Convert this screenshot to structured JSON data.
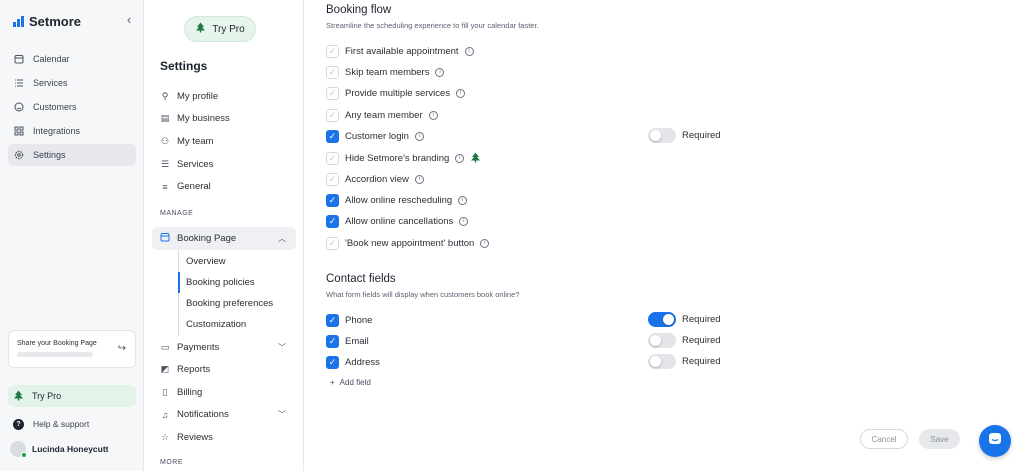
{
  "app": {
    "name": "Setmore"
  },
  "rail": {
    "items": [
      {
        "label": "Calendar",
        "icon": "calendar-icon"
      },
      {
        "label": "Services",
        "icon": "list-icon"
      },
      {
        "label": "Customers",
        "icon": "smiley-icon"
      },
      {
        "label": "Integrations",
        "icon": "grid-icon"
      },
      {
        "label": "Settings",
        "icon": "gear-icon",
        "active": true
      }
    ],
    "share": {
      "title": "Share your Booking Page"
    },
    "try_pro": "Try Pro",
    "help": "Help & support",
    "user_name": "Lucinda Honeycutt"
  },
  "panel": {
    "try_pro": "Try Pro",
    "title": "Settings",
    "items": [
      "My profile",
      "My business",
      "My team",
      "Services",
      "General"
    ],
    "manage_label": "MANAGE",
    "booking_page": "Booking Page",
    "sub_items": [
      "Overview",
      "Booking policies",
      "Booking preferences",
      "Customization"
    ],
    "items2": [
      "Payments",
      "Reports",
      "Billing",
      "Notifications",
      "Reviews"
    ],
    "more_label": "MORE"
  },
  "booking_flow": {
    "title": "Booking flow",
    "subtitle": "Streamline the scheduling experience to fill your calendar faster.",
    "options": [
      {
        "label": "First available appointment",
        "checked": false
      },
      {
        "label": "Skip team members",
        "checked": false
      },
      {
        "label": "Provide multiple services",
        "checked": false
      },
      {
        "label": "Any team member",
        "checked": false
      },
      {
        "label": "Customer login",
        "checked": true
      },
      {
        "label": "Hide Setmore's branding",
        "checked": false
      },
      {
        "label": "Accordion view",
        "checked": false
      },
      {
        "label": "Allow online rescheduling",
        "checked": true
      },
      {
        "label": "Allow online cancellations",
        "checked": true
      },
      {
        "label": "'Book new appointment' button",
        "checked": false
      }
    ],
    "customer_login_required": {
      "label": "Required",
      "on": false
    }
  },
  "contact_fields": {
    "title": "Contact fields",
    "subtitle": "What form fields will display when customers book online?",
    "fields": [
      {
        "label": "Phone",
        "checked": true,
        "required_label": "Required",
        "required": true
      },
      {
        "label": "Email",
        "checked": true,
        "required_label": "Required",
        "required": false
      },
      {
        "label": "Address",
        "checked": true,
        "required_label": "Required",
        "required": false
      }
    ],
    "add_field": "Add field"
  },
  "actions": {
    "cancel": "Cancel",
    "save": "Save"
  },
  "colors": {
    "accent": "#1a73e8",
    "pro_green": "#1e7a45"
  }
}
